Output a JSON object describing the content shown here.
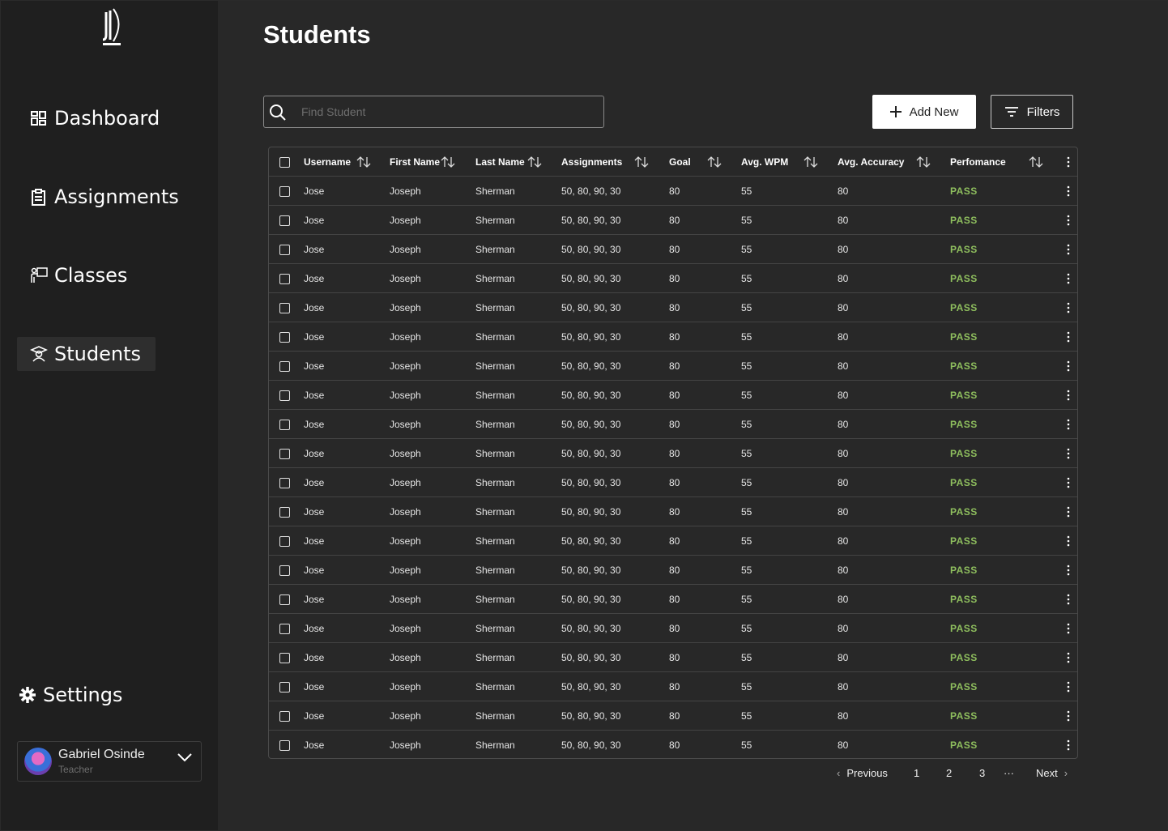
{
  "sidebar": {
    "nav": [
      {
        "label": "Dashboard",
        "icon": "dashboard-icon"
      },
      {
        "label": "Assignments",
        "icon": "clipboard-icon"
      },
      {
        "label": "Classes",
        "icon": "teacher-board-icon"
      },
      {
        "label": "Students",
        "icon": "student-icon"
      }
    ],
    "active": "Students",
    "settings_label": "Settings",
    "user": {
      "name": "Gabriel Osinde",
      "role": "Teacher"
    }
  },
  "main": {
    "title": "Students",
    "search": {
      "placeholder": "Find Student",
      "value": ""
    },
    "add_label": "Add New",
    "filters_label": "Filters"
  },
  "table": {
    "columns": [
      "Username",
      "First Name",
      "Last Name",
      "Assignments",
      "Goal",
      "Avg. WPM",
      "Avg. Accuracy",
      "Perfomance"
    ],
    "rows": [
      [
        "Jose",
        "Joseph",
        "Sherman",
        "50, 80, 90, 30",
        "80",
        "55",
        "80",
        "PASS"
      ],
      [
        "Jose",
        "Joseph",
        "Sherman",
        "50, 80, 90, 30",
        "80",
        "55",
        "80",
        "PASS"
      ],
      [
        "Jose",
        "Joseph",
        "Sherman",
        "50, 80, 90, 30",
        "80",
        "55",
        "80",
        "PASS"
      ],
      [
        "Jose",
        "Joseph",
        "Sherman",
        "50, 80, 90, 30",
        "80",
        "55",
        "80",
        "PASS"
      ],
      [
        "Jose",
        "Joseph",
        "Sherman",
        "50, 80, 90, 30",
        "80",
        "55",
        "80",
        "PASS"
      ],
      [
        "Jose",
        "Joseph",
        "Sherman",
        "50, 80, 90, 30",
        "80",
        "55",
        "80",
        "PASS"
      ],
      [
        "Jose",
        "Joseph",
        "Sherman",
        "50, 80, 90, 30",
        "80",
        "55",
        "80",
        "PASS"
      ],
      [
        "Jose",
        "Joseph",
        "Sherman",
        "50, 80, 90, 30",
        "80",
        "55",
        "80",
        "PASS"
      ],
      [
        "Jose",
        "Joseph",
        "Sherman",
        "50, 80, 90, 30",
        "80",
        "55",
        "80",
        "PASS"
      ],
      [
        "Jose",
        "Joseph",
        "Sherman",
        "50, 80, 90, 30",
        "80",
        "55",
        "80",
        "PASS"
      ],
      [
        "Jose",
        "Joseph",
        "Sherman",
        "50, 80, 90, 30",
        "80",
        "55",
        "80",
        "PASS"
      ],
      [
        "Jose",
        "Joseph",
        "Sherman",
        "50, 80, 90, 30",
        "80",
        "55",
        "80",
        "PASS"
      ],
      [
        "Jose",
        "Joseph",
        "Sherman",
        "50, 80, 90, 30",
        "80",
        "55",
        "80",
        "PASS"
      ],
      [
        "Jose",
        "Joseph",
        "Sherman",
        "50, 80, 90, 30",
        "80",
        "55",
        "80",
        "PASS"
      ],
      [
        "Jose",
        "Joseph",
        "Sherman",
        "50, 80, 90, 30",
        "80",
        "55",
        "80",
        "PASS"
      ],
      [
        "Jose",
        "Joseph",
        "Sherman",
        "50, 80, 90, 30",
        "80",
        "55",
        "80",
        "PASS"
      ],
      [
        "Jose",
        "Joseph",
        "Sherman",
        "50, 80, 90, 30",
        "80",
        "55",
        "80",
        "PASS"
      ],
      [
        "Jose",
        "Joseph",
        "Sherman",
        "50, 80, 90, 30",
        "80",
        "55",
        "80",
        "PASS"
      ],
      [
        "Jose",
        "Joseph",
        "Sherman",
        "50, 80, 90, 30",
        "80",
        "55",
        "80",
        "PASS"
      ],
      [
        "Jose",
        "Joseph",
        "Sherman",
        "50, 80, 90, 30",
        "80",
        "55",
        "80",
        "PASS"
      ]
    ]
  },
  "pagination": {
    "previous": "Previous",
    "pages": [
      "1",
      "2",
      "3"
    ],
    "ellipsis": "···",
    "next": "Next"
  },
  "colors": {
    "background": "#282828",
    "sidebar": "#1f1f1f",
    "pass": "#8fbf5e",
    "border": "#444444"
  }
}
